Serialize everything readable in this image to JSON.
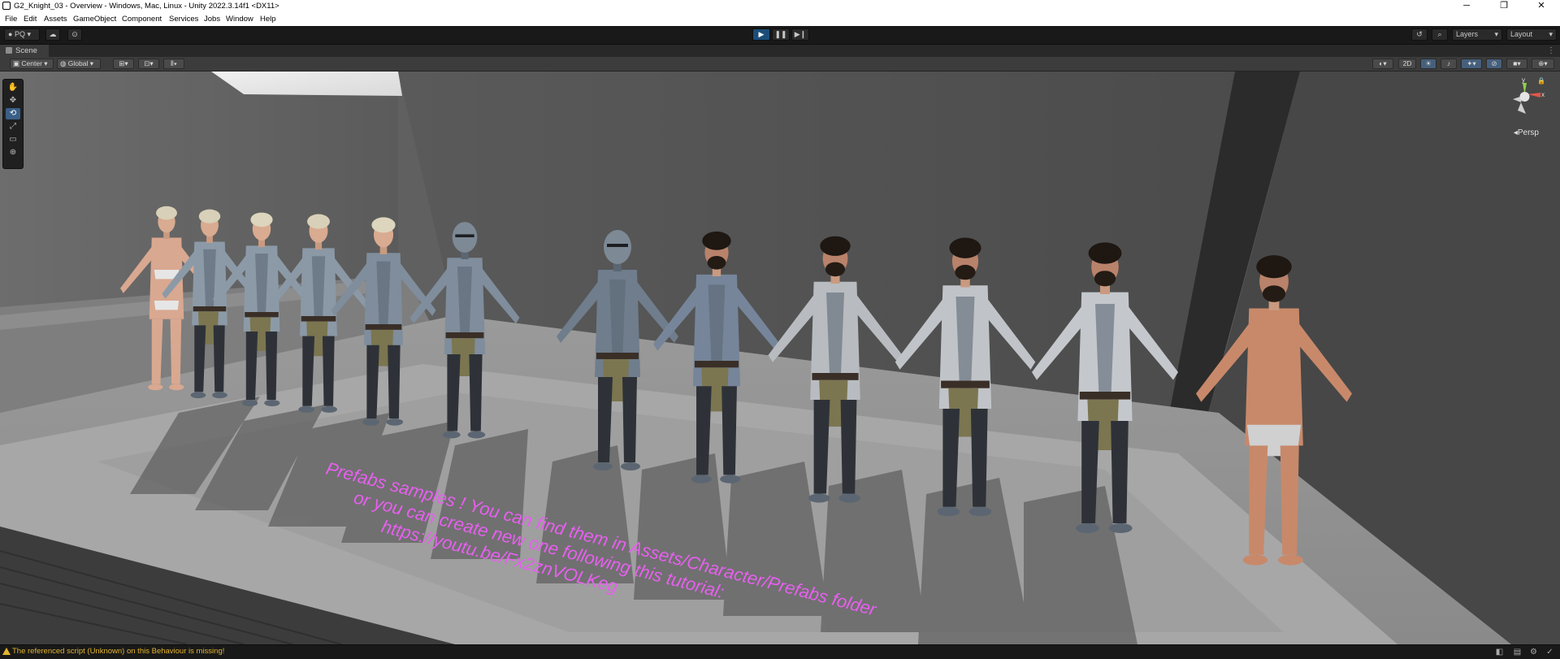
{
  "window": {
    "title": "G2_Knight_03 - Overview - Windows, Mac, Linux - Unity 2022.3.14f1 <DX11>",
    "controls": {
      "minimize": "─",
      "maximize": "❐",
      "close": "✕"
    }
  },
  "menu": [
    "File",
    "Edit",
    "Assets",
    "GameObject",
    "Component",
    "Services",
    "Jobs",
    "Window",
    "Help"
  ],
  "toolbar": {
    "account": "PQ",
    "play": "▶",
    "pause": "❚❚",
    "step": "▶❙",
    "layers": "Layers",
    "layout": "Layout"
  },
  "scene_tab": {
    "label": "Scene"
  },
  "scene_toolbar": {
    "pivot": "Center",
    "space": "Global",
    "mode_2d": "2D"
  },
  "viewport": {
    "caption_lines": [
      "Prefabs samples ! You can find them in Assets/Character/Prefabs folder",
      "or you can create new one following this tutorial:",
      "https://youtu.be/Fx2znVOLKeg"
    ],
    "gizmo": {
      "y": "y",
      "x": "x",
      "projection": "Persp"
    },
    "characters": [
      {
        "kind": "female",
        "hair": "#d8d0b8",
        "body": "#d9a890",
        "armor": false
      },
      {
        "kind": "female",
        "hair": "#d8d0b8",
        "body": "#8c9aa8",
        "armor": true
      },
      {
        "kind": "female",
        "hair": "#ddd5bd",
        "body": "#8c9aa8",
        "armor": true
      },
      {
        "kind": "female",
        "hair": "#d8d0b8",
        "body": "#8b98a6",
        "armor": true
      },
      {
        "kind": "female",
        "hair": "#ddd5bd",
        "body": "#7f8d9c",
        "armor": true
      },
      {
        "kind": "helmet",
        "hair": "#6a7580",
        "body": "#7f8d9c",
        "armor": true
      },
      {
        "kind": "helmet",
        "hair": "#6a7580",
        "body": "#6f7d8c",
        "armor": true
      },
      {
        "kind": "male",
        "hair": "#1e1712",
        "body": "#76859a",
        "armor": true
      },
      {
        "kind": "male",
        "hair": "#1e1712",
        "body": "#b8bcc0",
        "armor": true
      },
      {
        "kind": "male",
        "hair": "#1e1712",
        "body": "#c0c4c8",
        "armor": true
      },
      {
        "kind": "male",
        "hair": "#1e1712",
        "body": "#c4c8cc",
        "armor": true
      },
      {
        "kind": "shirtless",
        "hair": "#1e1712",
        "body": "#c8896a",
        "armor": false
      }
    ]
  },
  "status": {
    "message": "The referenced script (Unknown) on this Behaviour is missing!",
    "color": "#e3b42e"
  }
}
